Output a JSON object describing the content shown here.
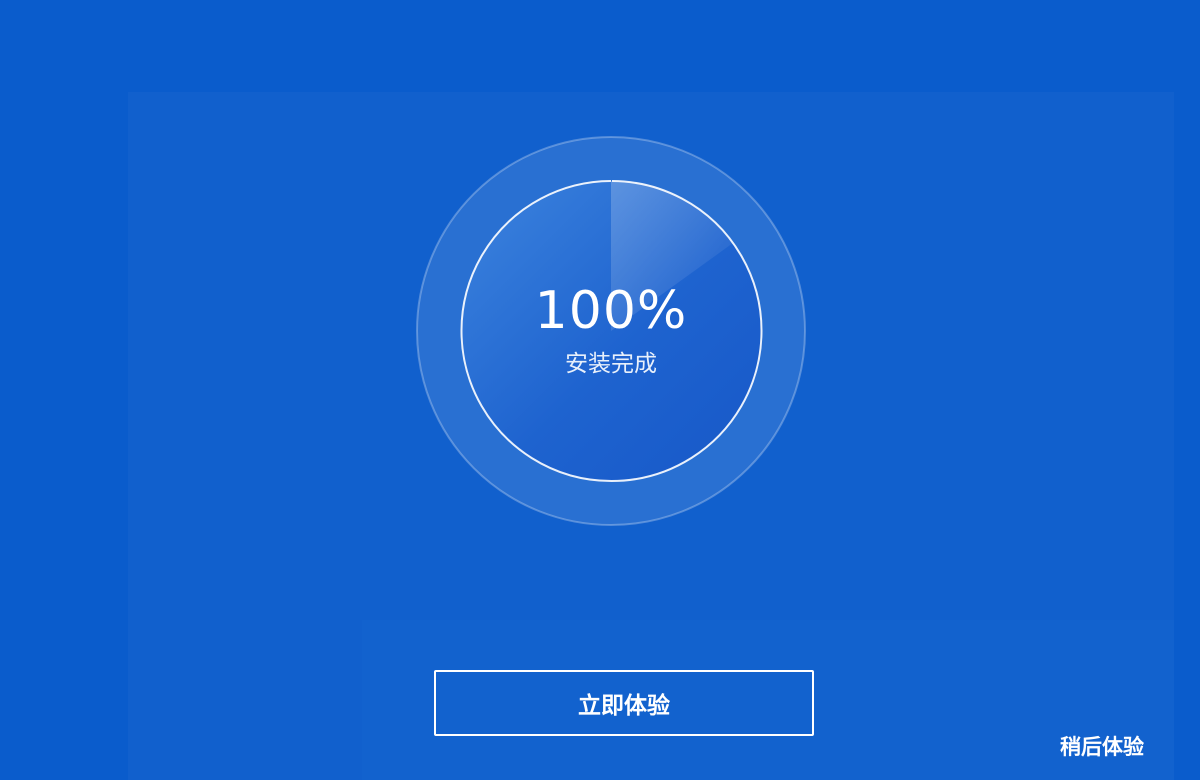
{
  "progress": {
    "percent_label": "100%",
    "status_label": "安装完成",
    "value": 1.0
  },
  "actions": {
    "primary_label": "立即体验",
    "secondary_label": "稍后体验"
  },
  "colors": {
    "background": "#0a5ccc",
    "panel": "#1160cd",
    "ring": "#ffffff"
  }
}
